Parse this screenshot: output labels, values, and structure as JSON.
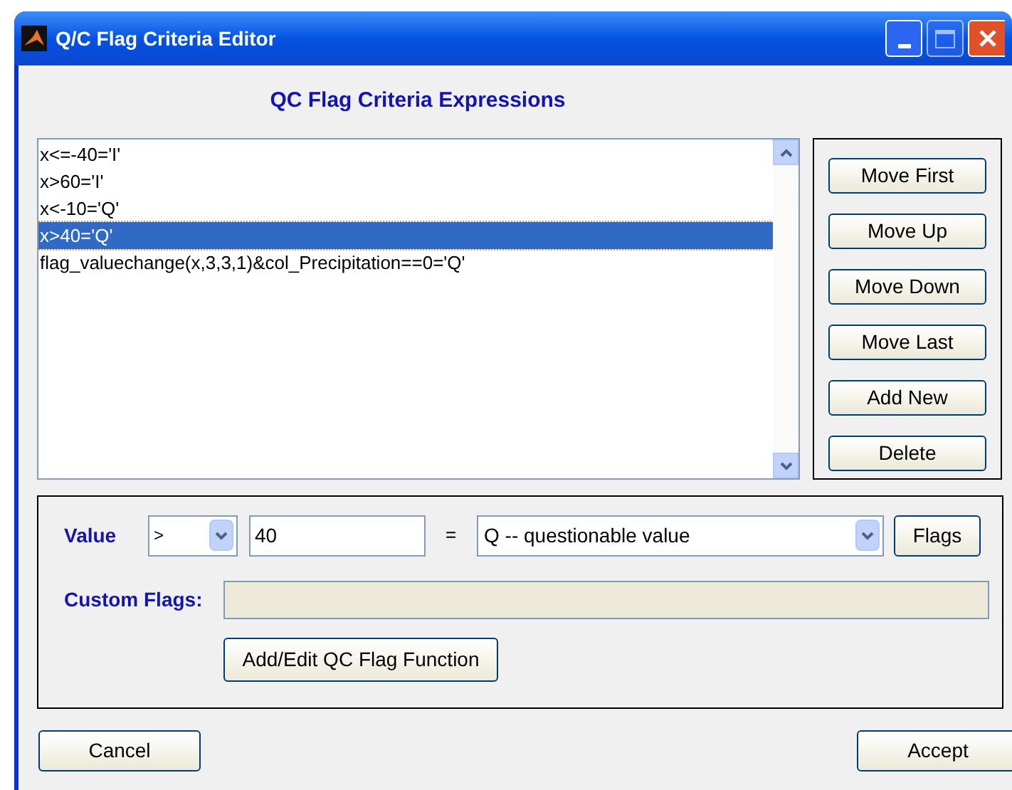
{
  "window": {
    "title": "Q/C Flag Criteria Editor"
  },
  "heading": "QC Flag Criteria Expressions",
  "expressions": [
    {
      "text": "x<=-40='I'",
      "selected": false
    },
    {
      "text": "x>60='I'",
      "selected": false
    },
    {
      "text": "x<-10='Q'",
      "selected": false
    },
    {
      "text": "x>40='Q'",
      "selected": true
    },
    {
      "text": "flag_valuechange(x,3,3,1)&col_Precipitation==0='Q'",
      "selected": false
    }
  ],
  "order_buttons": [
    "Move First",
    "Move Up",
    "Move Down",
    "Move Last",
    "Add New",
    "Delete"
  ],
  "value_label": "Value",
  "operator": ">",
  "value": "40",
  "equals": "=",
  "flag": "Q -- questionable value",
  "flags_button": "Flags",
  "custom_flags_label": "Custom Flags:",
  "function_button": "Add/Edit QC Flag Function",
  "cancel_button": "Cancel",
  "accept_button": "Accept"
}
